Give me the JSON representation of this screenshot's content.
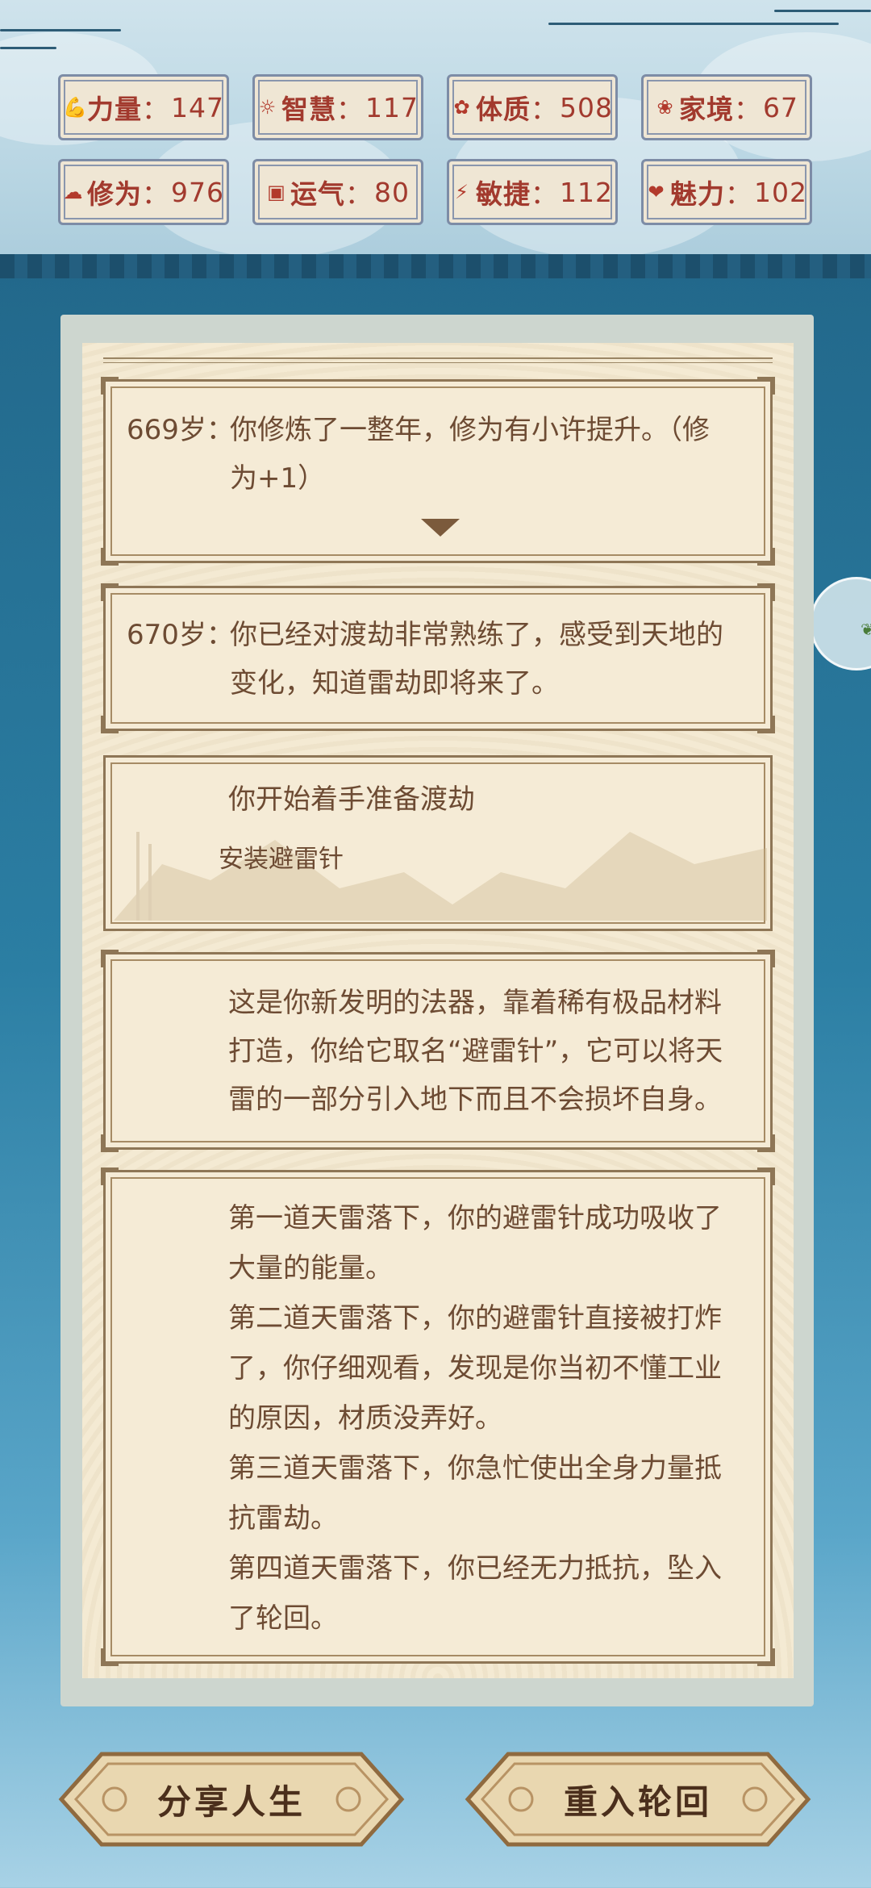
{
  "stats": [
    {
      "icon": "muscle-icon",
      "label": "力量",
      "value": "147"
    },
    {
      "icon": "bulb-icon",
      "label": "智慧",
      "value": "117"
    },
    {
      "icon": "body-icon",
      "label": "体质",
      "value": "508"
    },
    {
      "icon": "home-icon",
      "label": "家境",
      "value": "67"
    },
    {
      "icon": "cloud-icon",
      "label": "修为",
      "value": "976"
    },
    {
      "icon": "luck-icon",
      "label": "运气",
      "value": "80"
    },
    {
      "icon": "lightning-icon",
      "label": "敏捷",
      "value": "112"
    },
    {
      "icon": "heart-icon",
      "label": "魅力",
      "value": "102"
    }
  ],
  "separator": "：",
  "events": [
    {
      "age": "669岁：",
      "lines": [
        "你修炼了一整年，修为有小许提升。（修",
        "为+1）"
      ]
    },
    {
      "age": "670岁：",
      "lines": [
        "你已经对渡劫非常熟练了，感受到天地的",
        "变化，知道雷劫即将来了。"
      ]
    }
  ],
  "choice": {
    "title": "你开始着手准备渡劫",
    "option": "安装避雷针"
  },
  "description": [
    "这是你新发明的法器，靠着稀有极品材料",
    "打造，你给它取名“避雷针”，它可以将天",
    "雷的一部分引入地下而且不会损坏自身。"
  ],
  "outcome": [
    "第一道天雷落下，你的避雷针成功吸收了",
    "大量的能量。",
    "第二道天雷落下，你的避雷针直接被打炸",
    "了，你仔细观看，发现是你当初不懂工业",
    "的原因，材质没弄好。",
    "第三道天雷落下，你急忙使出全身力量抵",
    "抗雷劫。",
    "第四道天雷落下，你已经无力抵抗，坠入",
    "了轮回。"
  ],
  "buttons": {
    "share": "分享人生",
    "restart": "重入轮回"
  },
  "colors": {
    "stat_text": "#a23a2e",
    "card_text": "#6d4b33",
    "frame": "#8e7656",
    "paper": "#f5ebd6"
  }
}
